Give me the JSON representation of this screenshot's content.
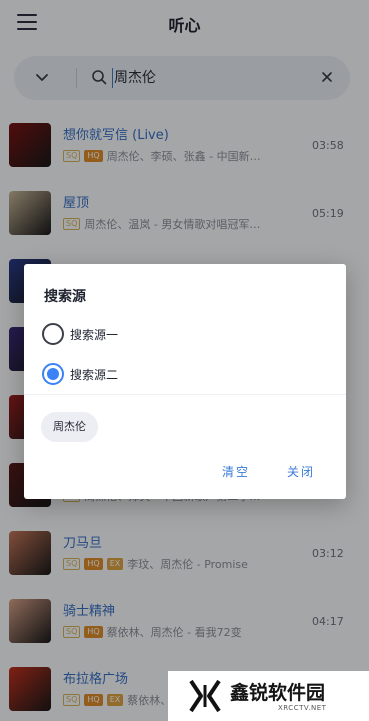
{
  "app": {
    "title": "听心"
  },
  "search": {
    "query": "周杰伦"
  },
  "songs": [
    {
      "title": "想你就写信 (Live)",
      "tags": [
        "SQ",
        "HQ"
      ],
      "artist": "周杰伦、李硕、张鑫 - 中国新…",
      "duration": "03:58",
      "cover_color": "#7a1414"
    },
    {
      "title": "屋顶",
      "tags": [
        "SQ"
      ],
      "artist": "周杰伦、温岚 - 男女情歌对唱冠军…",
      "duration": "05:19",
      "cover_color": "#c9b89a"
    },
    {
      "title": "",
      "tags": [],
      "artist": "",
      "duration": "",
      "cover_color": "#2a3c8f"
    },
    {
      "title": "",
      "tags": [],
      "artist": "",
      "duration": "",
      "cover_color": "#3b2a7a"
    },
    {
      "title": "",
      "tags": [],
      "artist": "",
      "duration": "",
      "cover_color": "#9b1f1f"
    },
    {
      "title": "",
      "tags": [
        "SQ"
      ],
      "artist": "周杰伦、郑爽 - 中国新歌声第二季…",
      "duration": "",
      "cover_color": "#5a1a1a"
    },
    {
      "title": "刀马旦",
      "tags": [
        "SQ",
        "HQ",
        "EX"
      ],
      "artist": "李玟、周杰伦 - Promise",
      "duration": "03:12",
      "cover_color": "#c4775a"
    },
    {
      "title": "骑士精神",
      "tags": [
        "SQ",
        "HQ"
      ],
      "artist": "蔡依林、周杰伦 - 看我72变",
      "duration": "04:17",
      "cover_color": "#d9a28a"
    },
    {
      "title": "布拉格广场",
      "tags": [
        "SQ",
        "HQ",
        "EX"
      ],
      "artist": "蔡依林、周杰伦",
      "duration": "",
      "cover_color": "#c2321f"
    }
  ],
  "tag_labels": {
    "SQ": "SQ",
    "HQ": "HQ",
    "EX": "EX"
  },
  "dialog": {
    "title": "搜索源",
    "options": [
      {
        "label": "搜索源一",
        "selected": false
      },
      {
        "label": "搜索源二",
        "selected": true
      }
    ],
    "history_chip": "周杰伦",
    "clear_label": "清空",
    "close_label": "关闭"
  },
  "watermark": {
    "name": "鑫锐软件园",
    "url": "XRCCTV.NET"
  },
  "colors": {
    "accent": "#3b82f6",
    "link": "#3771c8"
  },
  "icons": [
    "menu-icon",
    "chevron-down-icon",
    "search-icon",
    "close-icon",
    "radio-icon"
  ]
}
